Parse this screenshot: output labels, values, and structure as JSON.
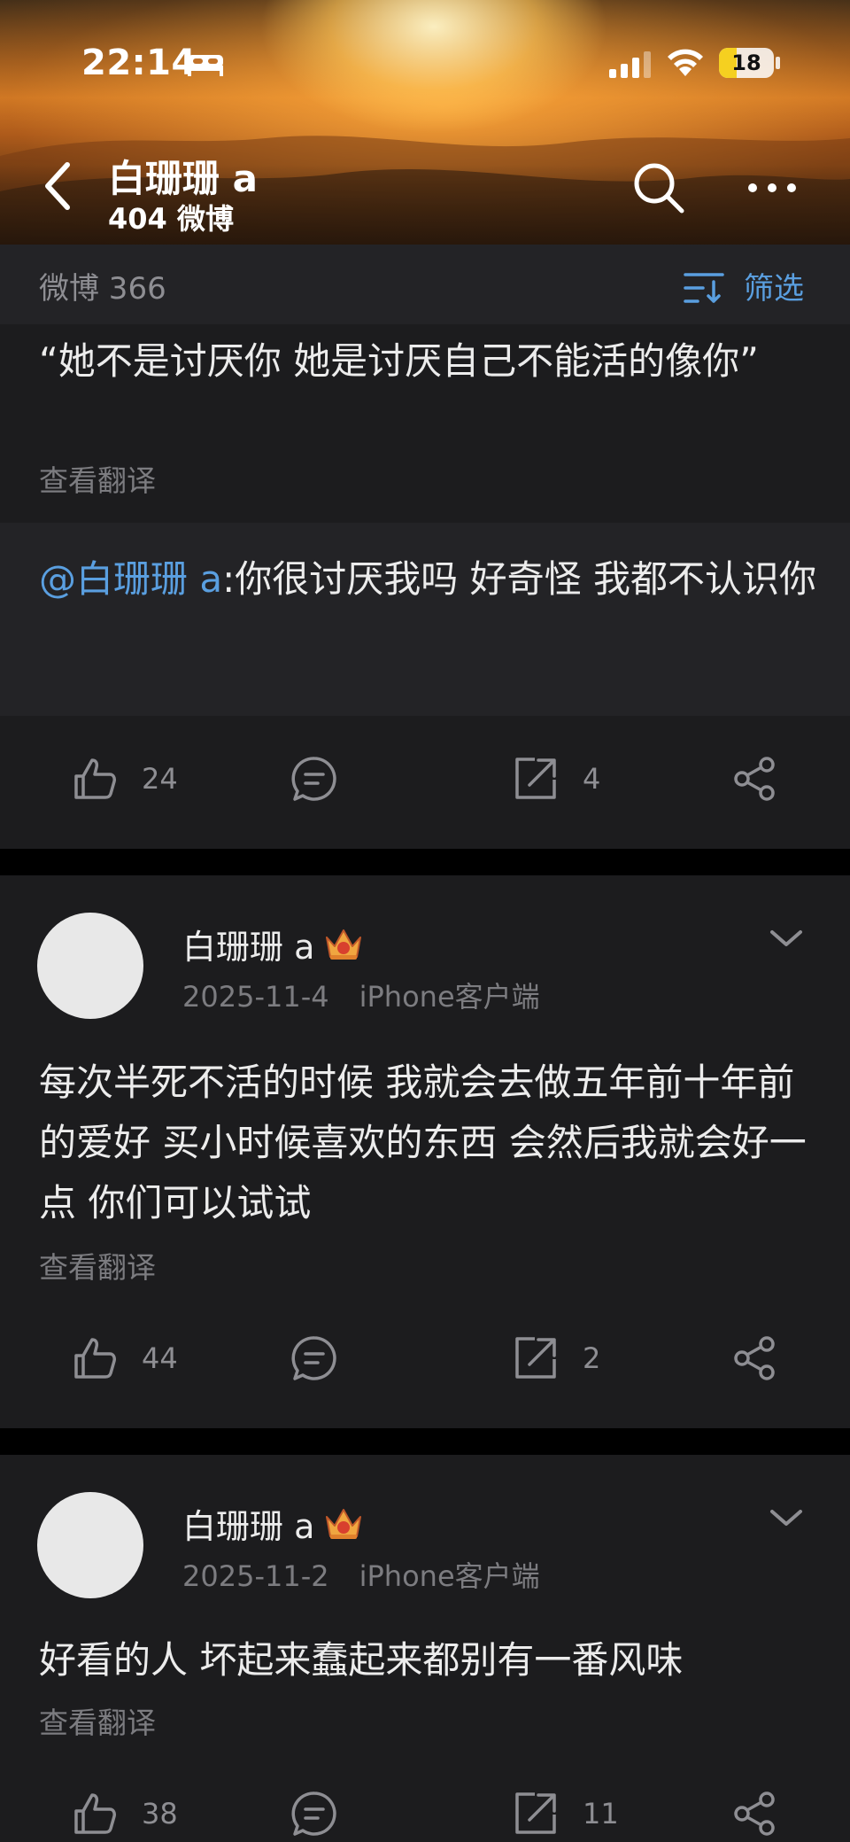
{
  "status_bar": {
    "time": "22:14",
    "battery": "18"
  },
  "nav": {
    "title": "白珊珊 a",
    "subtitle": "404 微博"
  },
  "filter_bar": {
    "count_label": "微博 366",
    "filter_label": "筛选"
  },
  "posts": [
    {
      "text": "“她不是讨厌你 她是讨厌自己不能活的像你”",
      "translate": "查看翻译",
      "quote": {
        "mention": "@白珊珊 a",
        "text": ":你很讨厌我吗 好奇怪 我都不认识你"
      },
      "likes": "24",
      "reposts": "4"
    },
    {
      "author": "白珊珊 a",
      "date": "2025-11-4",
      "source": "iPhone客户端",
      "text": "每次半死不活的时候 我就会去做五年前十年前的爱好 买小时候喜欢的东西 会然后我就会好一点 你们可以试试",
      "translate": "查看翻译",
      "likes": "44",
      "reposts": "2"
    },
    {
      "author": "白珊珊 a",
      "date": "2025-11-2",
      "source": "iPhone客户端",
      "text": "好看的人 坏起来蠢起来都别有一番风味",
      "translate": "查看翻译",
      "likes": "38",
      "reposts": "11"
    }
  ],
  "colors": {
    "accent": "#5a9fe0",
    "card": "#1c1c1e",
    "quote_bg": "#232326",
    "muted": "#7c7c80"
  }
}
